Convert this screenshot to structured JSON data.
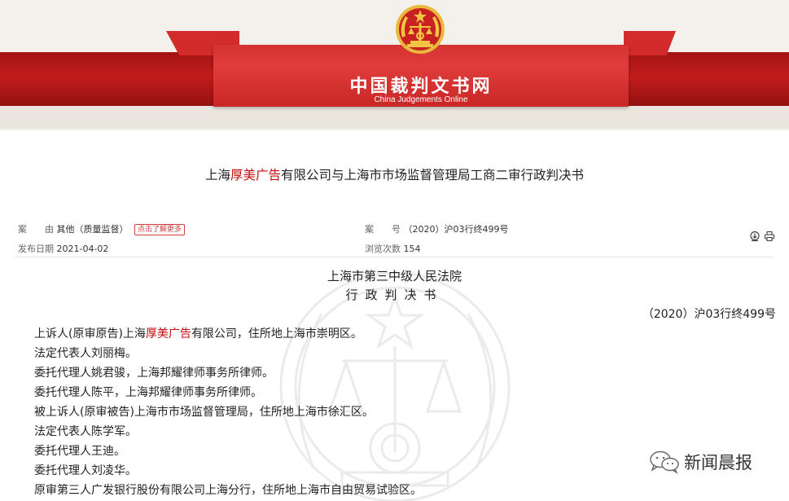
{
  "header": {
    "site_title": "中国裁判文书网",
    "site_subtitle": "China Judgements Online",
    "emblem": "court-emblem"
  },
  "document": {
    "title_pre": "上海",
    "title_highlight": "厚美广告",
    "title_post": "有限公司与上海市市场监督管理局工商二审行政判决书"
  },
  "meta": {
    "cause_label": "案　　由",
    "cause_value": "其他（质量监督）",
    "learn_more": "点击了解更多",
    "case_no_label": "案　　号",
    "case_no_value": "（2020）沪03行终499号",
    "publish_label": "发布日期",
    "publish_value": "2021-04-02",
    "views_label": "浏览次数",
    "views_value": "154"
  },
  "toolbar": {
    "download_icon": "download-icon",
    "print_icon": "print-icon"
  },
  "body": {
    "court": "上海市第三中级人民法院",
    "doc_type": "行政判决书",
    "case_no": "（2020）沪03行终499号",
    "p1_pre": "上诉人(原审原告)上海",
    "p1_highlight": "厚美广告",
    "p1_post": "有限公司，住所地上海市崇明区。",
    "paragraphs": [
      "法定代表人刘丽梅。",
      "委托代理人姚君骏，上海邦耀律师事务所律师。",
      "委托代理人陈平，上海邦耀律师事务所律师。",
      "被上诉人(原审被告)上海市市场监督管理局，住所地上海市徐汇区。",
      "法定代表人陈学军。",
      "委托代理人王迪。",
      "委托代理人刘凌华。",
      "原审第三人广发银行股份有限公司上海分行，住所地上海市自由贸易试验区。"
    ]
  },
  "watermark": {
    "text": "新闻晨报",
    "icon": "wechat-icon"
  },
  "colors": {
    "banner_red": "#c92626",
    "highlight_red": "#c40d0d",
    "emblem_gold": "#e8b93a"
  }
}
